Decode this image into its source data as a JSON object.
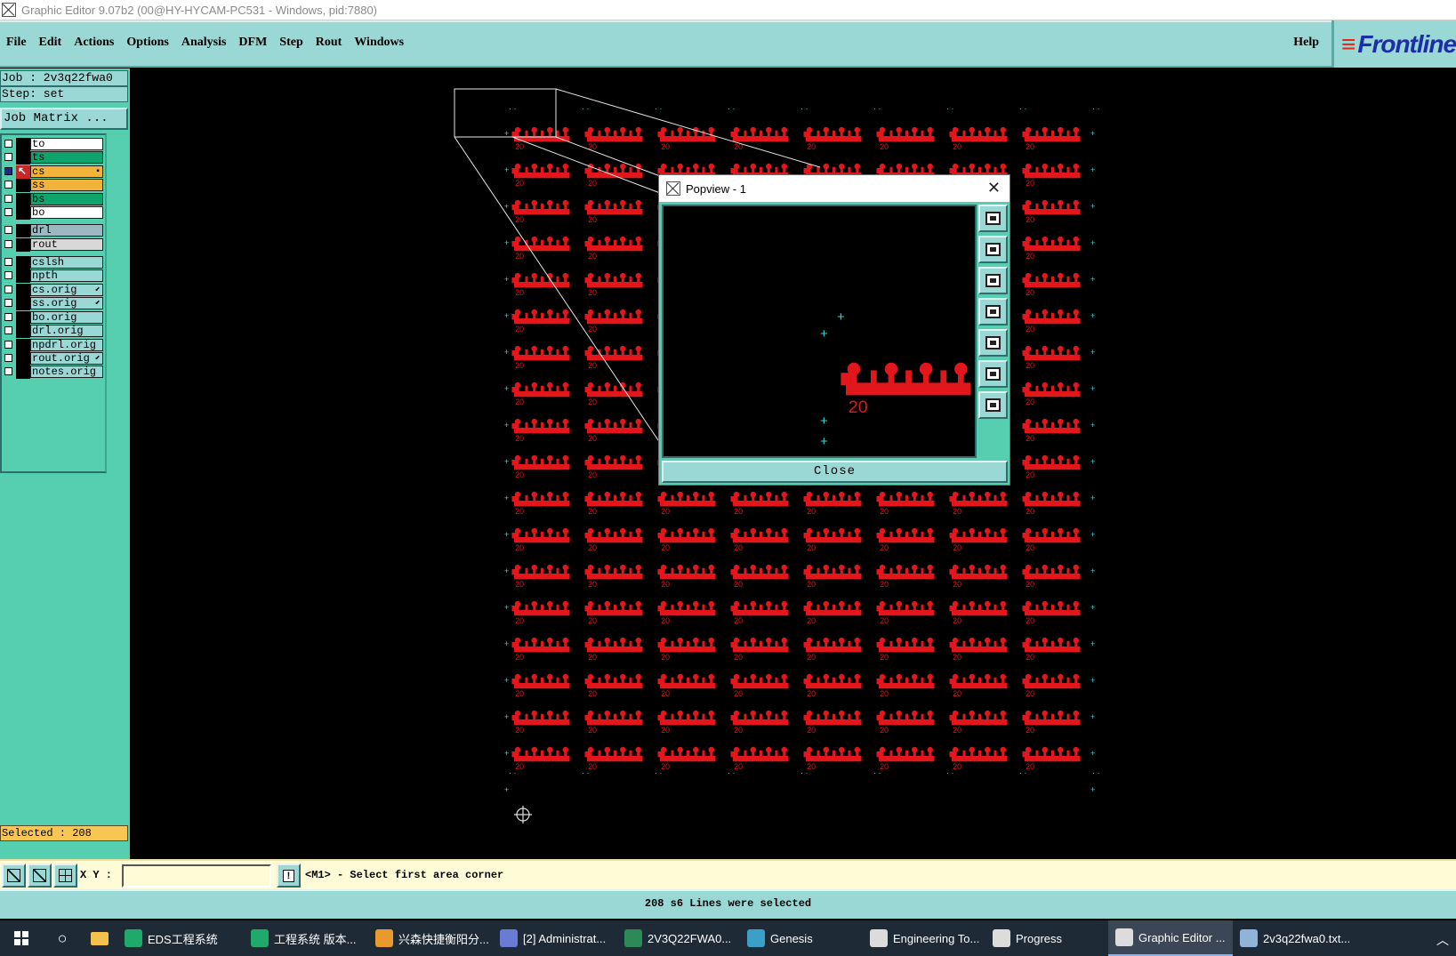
{
  "title_bar": {
    "text": "Graphic Editor 9.07b2 (00@HY-HYCAM-PC531 - Windows, pid:7880)"
  },
  "menu": {
    "items": [
      "File",
      "Edit",
      "Actions",
      "Options",
      "Analysis",
      "DFM",
      "Step",
      "Rout",
      "Windows"
    ],
    "help": "Help",
    "logo": "Frontline"
  },
  "job_info": {
    "job": "Job : 2v3q22fwa0",
    "step": "Step: set",
    "matrix_button": "Job Matrix ..."
  },
  "layers": [
    {
      "name": "to",
      "color": "#ffffff",
      "checked": false,
      "marker": "none",
      "tag": ""
    },
    {
      "name": "ts",
      "color": "#0fa36e",
      "checked": false,
      "marker": "none",
      "tag": ""
    },
    {
      "name": "cs",
      "color": "#f2b33a",
      "checked": true,
      "marker": "arrow",
      "tag": "▪"
    },
    {
      "name": "ss",
      "color": "#f2b33a",
      "checked": false,
      "marker": "none",
      "tag": ""
    },
    {
      "name": "bs",
      "color": "#0fa36e",
      "checked": false,
      "marker": "none",
      "tag": ""
    },
    {
      "name": "bo",
      "color": "#ffffff",
      "checked": false,
      "marker": "none",
      "tag": ""
    },
    {
      "name": "drl",
      "color": "#9cb8c3",
      "checked": false,
      "marker": "none",
      "tag": ""
    },
    {
      "name": "rout",
      "color": "#d8d8d8",
      "checked": false,
      "marker": "none",
      "tag": ""
    },
    {
      "name": "cslsh",
      "color": "#9ad8d6",
      "checked": false,
      "marker": "none",
      "tag": ""
    },
    {
      "name": "npth",
      "color": "#9ad8d6",
      "checked": false,
      "marker": "none",
      "tag": ""
    },
    {
      "name": "cs.orig",
      "color": "#9ad8d6",
      "checked": false,
      "marker": "none",
      "tag": "⬋"
    },
    {
      "name": "ss.orig",
      "color": "#9ad8d6",
      "checked": false,
      "marker": "none",
      "tag": "⬋"
    },
    {
      "name": "bo.orig",
      "color": "#9ad8d6",
      "checked": false,
      "marker": "none",
      "tag": ""
    },
    {
      "name": "drl.orig",
      "color": "#9ad8d6",
      "checked": false,
      "marker": "none",
      "tag": ""
    },
    {
      "name": "npdrl.orig",
      "color": "#9ad8d6",
      "checked": false,
      "marker": "none",
      "tag": ""
    },
    {
      "name": "rout.orig",
      "color": "#9ad8d6",
      "checked": false,
      "marker": "none",
      "tag": "⬋"
    },
    {
      "name": "notes.orig",
      "color": "#9ad8d6",
      "checked": false,
      "marker": "none",
      "tag": ""
    }
  ],
  "selected_count": "Selected : 208",
  "popview": {
    "title": "Popview - 1",
    "close_label": "Close",
    "tools": [
      "zoom-window-icon",
      "pan-up-icon",
      "pan-down-icon",
      "pan-left-icon",
      "pan-right-icon",
      "zoom-home-icon",
      "zoom-fit-icon"
    ],
    "part_label": "20"
  },
  "board": {
    "rows": 18,
    "cols": 8,
    "part_label": "20",
    "part_color": "#e3161b",
    "marker_color": "#33d5d8"
  },
  "command": {
    "xy_label": "X Y :",
    "xy_value": "",
    "prompt": "<M1> - Select first area corner"
  },
  "status": "208 s6 Lines were selected",
  "taskbar": {
    "tasks": [
      {
        "label": "EDS工程系统",
        "color": "#1faa6b",
        "active": false
      },
      {
        "label": "工程系统   版本...",
        "color": "#1faa6b",
        "active": false
      },
      {
        "label": "兴森快捷衡阳分...",
        "color": "#e89a2c",
        "active": false
      },
      {
        "label": "[2] Administrat...",
        "color": "#6a7bd6",
        "active": false
      },
      {
        "label": "2V3Q22FWA0...",
        "color": "#2d8a57",
        "active": false
      },
      {
        "label": "Genesis",
        "color": "#3aa0c8",
        "active": false
      },
      {
        "label": "Engineering To...",
        "color": "#dcdcdc",
        "active": false
      },
      {
        "label": "Progress",
        "color": "#dcdcdc",
        "active": false
      },
      {
        "label": "Graphic Editor ...",
        "color": "#dcdcdc",
        "active": true
      },
      {
        "label": "2v3q22fwa0.txt...",
        "color": "#8fb3d9",
        "active": false
      }
    ]
  }
}
